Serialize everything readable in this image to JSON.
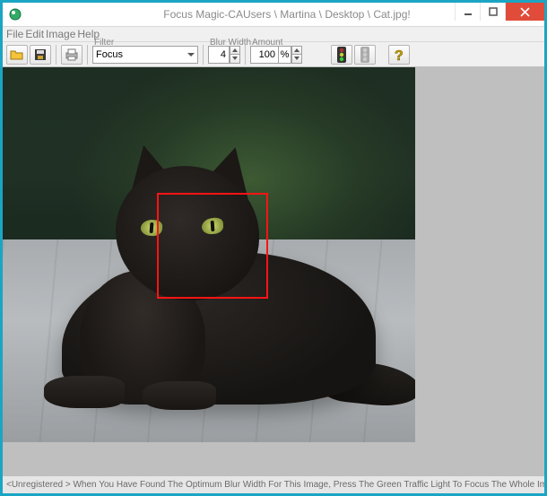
{
  "window": {
    "title": "Focus Magic-CAUsers \\ Martina \\ Desktop \\ Cat.jpg!"
  },
  "menu": {
    "file": "File",
    "edit": "Edit",
    "image": "Image",
    "help": "Help"
  },
  "toolbar": {
    "filter_label": "Filter",
    "filter_value": "Focus",
    "blur_width_label": "Blur Width",
    "blur_width_value": "4",
    "amount_label": "Amount",
    "amount_value": "100",
    "amount_unit": "%"
  },
  "icons": {
    "app": "app-icon",
    "open": "open-folder-icon",
    "save": "save-floppy-icon",
    "print": "print-icon",
    "go": "traffic-light-green-icon",
    "stop": "traffic-light-gray-icon",
    "help": "help-question-icon"
  },
  "status": {
    "text": "<Unregistered > When You Have Found The Optimum Blur Width For This Image, Press The Green Traffic Light To Focus The Whole Image."
  }
}
